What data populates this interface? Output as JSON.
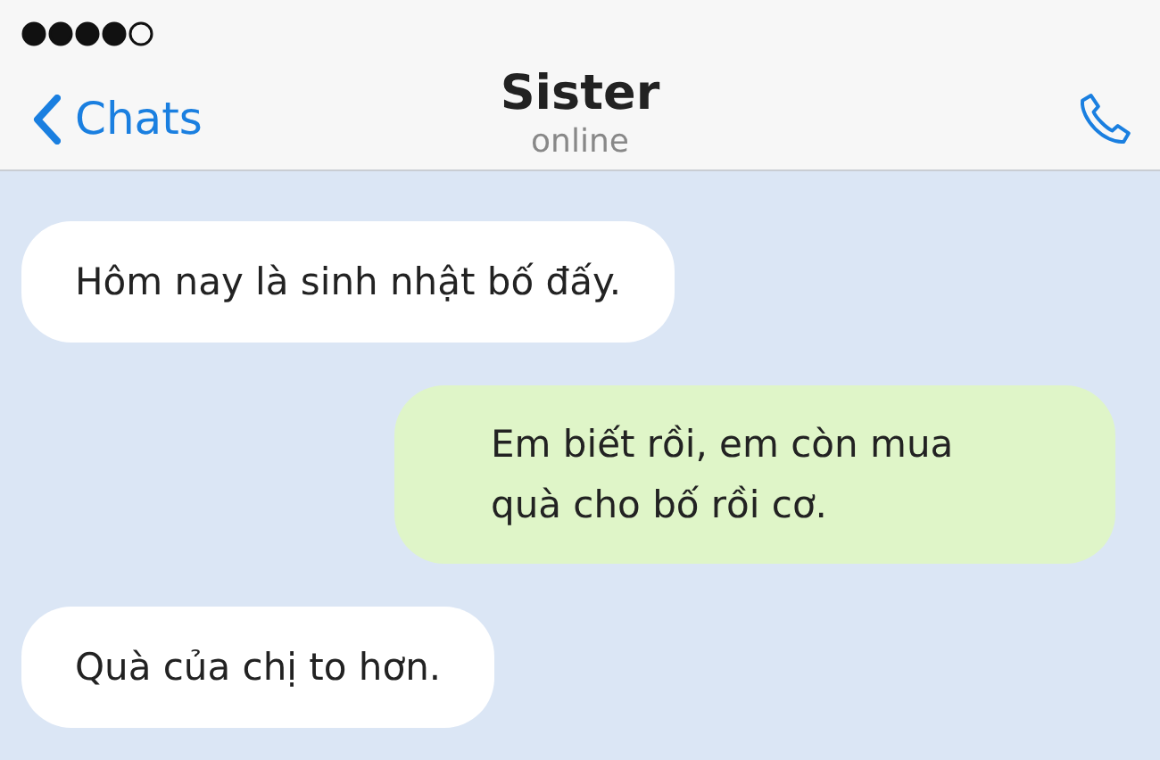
{
  "header": {
    "back": "Chats",
    "title": "Sister",
    "status": "online"
  },
  "messages": [
    {
      "kind": "received",
      "text": "Hôm nay là sinh nhật bố đấy."
    },
    {
      "kind": "sent",
      "text": "Em biết rồi, em còn mua quà cho bố rồi cơ."
    },
    {
      "kind": "received",
      "text": "Quà của chị to hơn."
    }
  ]
}
